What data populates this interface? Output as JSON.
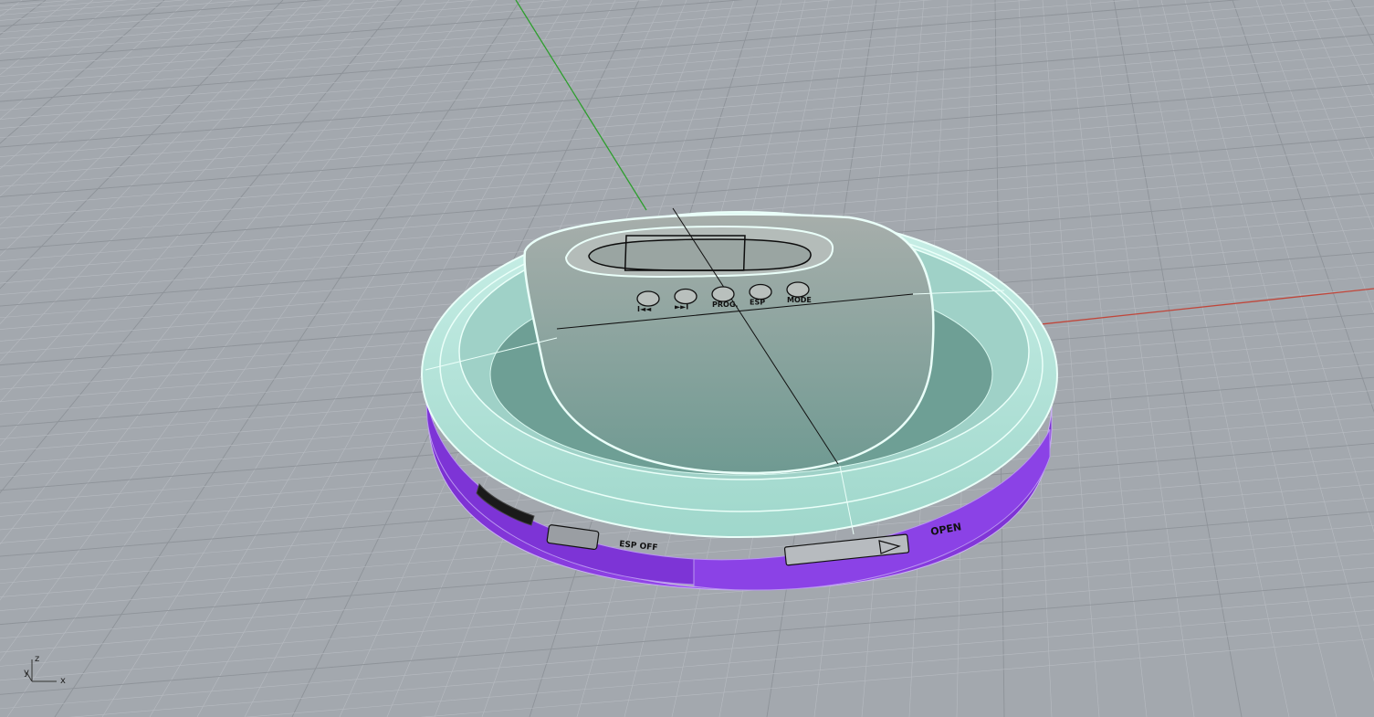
{
  "viewport": {
    "background_color": "#a3a8ae",
    "grid_minor_color": "#b7bbc1",
    "grid_major_color": "#8e9399",
    "x_axis_color": "#c0463a",
    "y_axis_color": "#2e9e2e"
  },
  "model": {
    "lid_color": "#bfe5dd",
    "lid_edge_color": "#e8fff8",
    "body_color": "#8a3ee0",
    "panel_color": "#9aa3a0",
    "buttons": [
      "I◄◄",
      "►►I",
      "PROG.",
      "ESP",
      "MODE"
    ],
    "side_labels": {
      "esp_switch": "ESP\nOFF",
      "open_label": "OPEN"
    }
  },
  "axis_widget": {
    "z_label": "z",
    "y_label": "y",
    "x_label": "x"
  }
}
